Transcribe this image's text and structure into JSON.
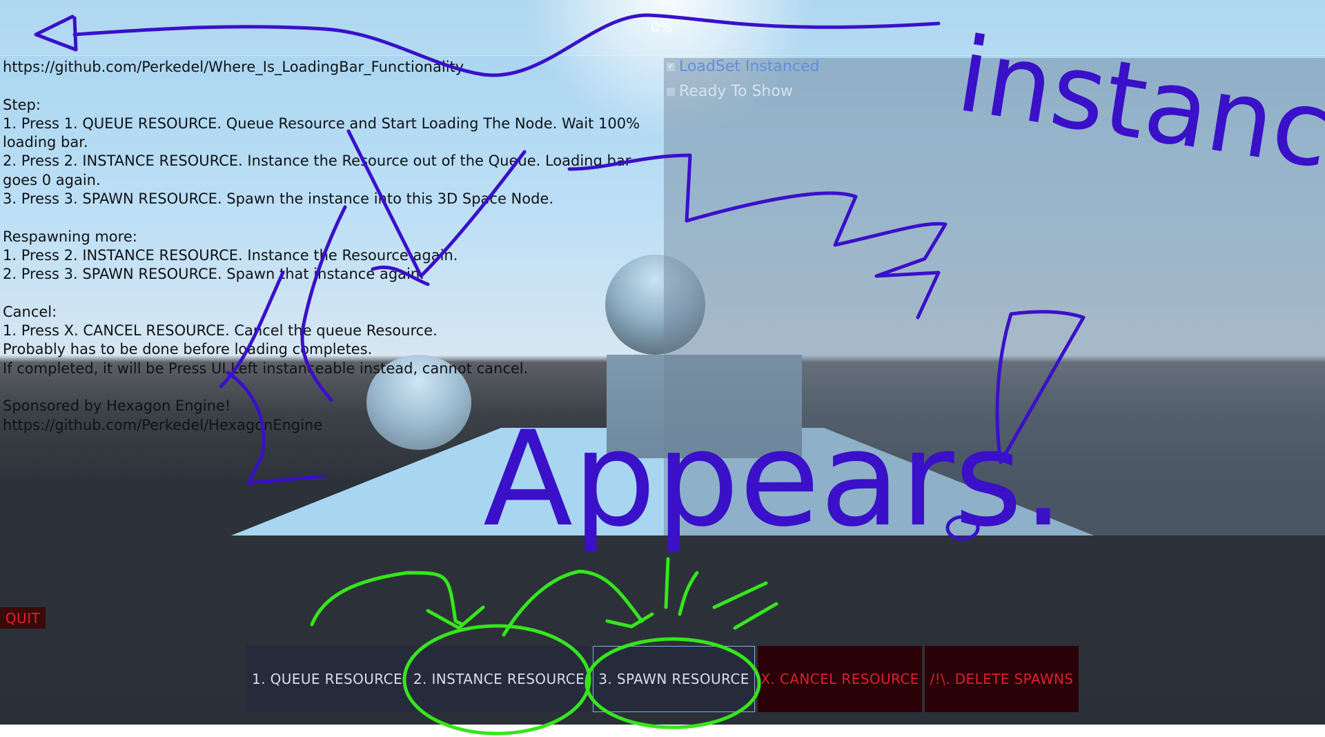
{
  "loading": {
    "progress_label": "0%",
    "progress": 0
  },
  "checks": [
    {
      "label": "LoadSet Instanced",
      "checked": true
    },
    {
      "label": "Ready To Show",
      "checked": false
    }
  ],
  "instructions": "https://github.com/Perkedel/Where_Is_LoadingBar_Functionality\n\nStep:\n1. Press 1. QUEUE RESOURCE. Queue Resource and Start Loading The Node. Wait 100%\nloading bar.\n2. Press 2. INSTANCE RESOURCE. Instance the Resource out of the Queue. Loading bar\ngoes 0 again.\n3. Press 3. SPAWN RESOURCE. Spawn the instance into this 3D Space Node.\n\nRespawning more:\n1. Press 2. INSTANCE RESOURCE. Instance the Resource again.\n2. Press 3. SPAWN RESOURCE. Spawn that instance again.\n\nCancel:\n1. Press X. CANCEL RESOURCE. Cancel the queue Resource.\nProbably has to be done before loading completes.\nIf completed, it will be Press UI Left instanceable instead, cannot cancel.\n\nSponsored by Hexagon Engine!\nhttps://github.com/Perkedel/HexagonEngine",
  "quit_label": "QUIT",
  "buttons": {
    "queue": "1. QUEUE RESOURCE",
    "instance": "2. INSTANCE RESOURCE",
    "spawn": "3. SPAWN RESOURCE",
    "cancel": "X. CANCEL RESOURCE",
    "delete": "/!\\. DELETE SPAWNS"
  },
  "annotations": {
    "instanced": "instanced!",
    "appears": "Appears."
  },
  "colors": {
    "ink_blue": "#3a10c8",
    "ink_green": "#35e61b",
    "danger_red": "#e01e2c"
  }
}
